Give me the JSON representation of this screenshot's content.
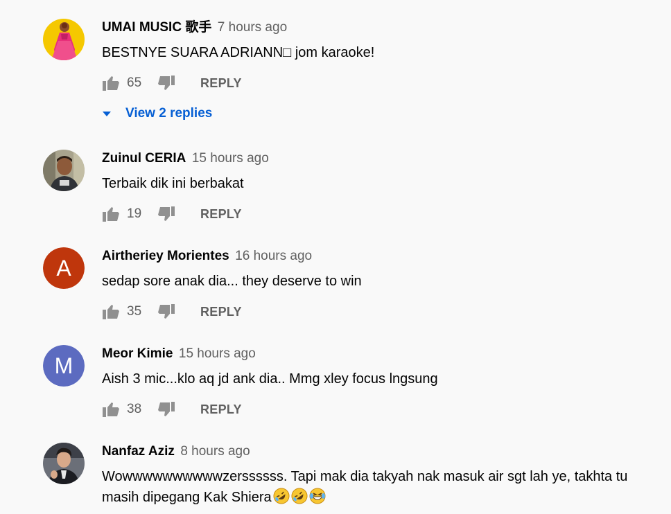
{
  "comments": [
    {
      "author": "UMAI MUSIC 歌手",
      "time": "7 hours ago",
      "text": "BESTNYE SUARA ADRIANN□ jom karaoke!",
      "likes": "65",
      "reply_label": "REPLY",
      "view_replies": "View 2 replies",
      "avatar": {
        "type": "image",
        "icon": "person-in-pink-outfit-avatar",
        "bg": "#f5c800"
      }
    },
    {
      "author": "Zuinul CERIA",
      "time": "15 hours ago",
      "text": "Terbaik dik ini berbakat",
      "likes": "19",
      "reply_label": "REPLY",
      "avatar": {
        "type": "image",
        "icon": "man-portrait-avatar",
        "bg": "#a8a38d"
      }
    },
    {
      "author": "Airtheriey Morientes",
      "time": "16 hours ago",
      "text": "sedap sore anak dia... they deserve to win",
      "likes": "35",
      "reply_label": "REPLY",
      "avatar": {
        "type": "letter",
        "letter": "A",
        "bg": "#bf360c"
      }
    },
    {
      "author": "Meor Kimie",
      "time": "15 hours ago",
      "text": "Aish 3 mic...klo aq jd ank dia.. Mmg xley focus lngsung",
      "likes": "38",
      "reply_label": "REPLY",
      "avatar": {
        "type": "letter",
        "letter": "M",
        "bg": "#5c6bc0"
      }
    },
    {
      "author": "Nanfaz Aziz",
      "time": "8 hours ago",
      "text": "Wowwwwwwwwwwzerssssss. Tapi mak dia takyah nak masuk air sgt lah ye, takhta tu masih dipegang Kak Shiera",
      "emojis": [
        "rolling-on-floor-laughing-emoji",
        "rolling-on-floor-laughing-emoji",
        "grinning-sweat-emoji"
      ],
      "avatar": {
        "type": "image",
        "icon": "man-in-suit-avatar",
        "bg": "#6b6f78"
      }
    }
  ],
  "colors": {
    "background": "#f9f9f9",
    "author": "#030303",
    "secondary": "#606060",
    "link": "#065fd4"
  }
}
